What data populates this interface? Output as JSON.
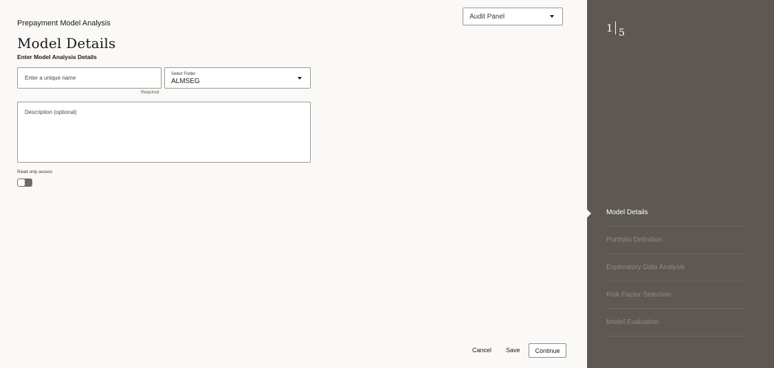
{
  "header": {
    "app_title": "Prepayment Model Analysis",
    "page_title": "Model Details",
    "subtitle": "Enter Model Analysis Details",
    "audit_panel": "Audit Panel"
  },
  "form": {
    "name_placeholder": "Enter a unique name",
    "name_helper": "Required",
    "folder_label": "Select Folder",
    "folder_value": "ALMSEG",
    "description_placeholder": "Description (optional)",
    "read_only_label": "Read only access",
    "read_only_enabled": false
  },
  "actions": {
    "cancel": "Cancel",
    "save": "Save",
    "continue": "Continue"
  },
  "train": {
    "current_step": "1",
    "total_steps": "5",
    "steps": [
      {
        "label": "Model Details",
        "active": true
      },
      {
        "label": "Portfolio Definition",
        "active": false
      },
      {
        "label": "Exploratory Data Analysis",
        "active": false
      },
      {
        "label": "Risk Factor Selection",
        "active": false
      },
      {
        "label": "Model Evaluation",
        "active": false
      }
    ]
  }
}
